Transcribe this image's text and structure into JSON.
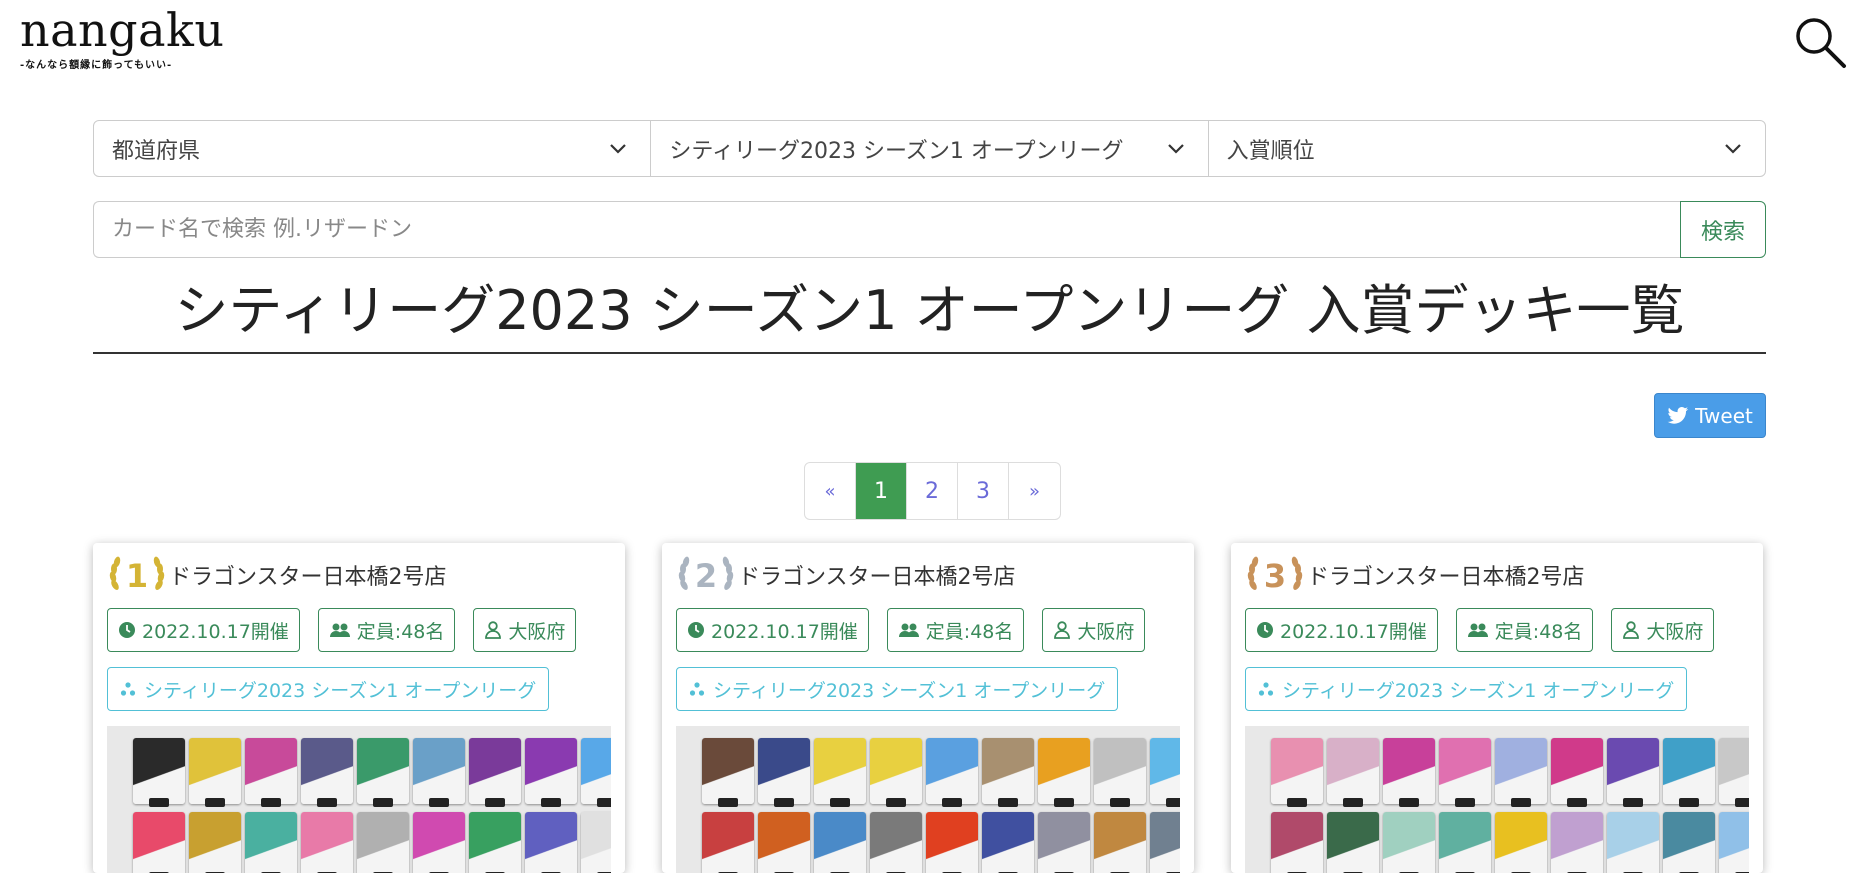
{
  "header": {
    "logo": "nangaku",
    "tagline": "-なんなら額縁に飾ってもいい-"
  },
  "filters": {
    "prefecture": "都道府県",
    "league": "シティリーグ2023 シーズン1 オープンリーグ",
    "rank": "入賞順位"
  },
  "search": {
    "placeholder": "カード名で検索 例.リザードン",
    "button_label": "検索"
  },
  "page_title": "シティリーグ2023 シーズン1 オープンリーグ 入賞デッキ一覧",
  "tweet_label": "Tweet",
  "pagination": {
    "prev": "«",
    "pages": [
      "1",
      "2",
      "3"
    ],
    "next": "»",
    "active": "1"
  },
  "cards": [
    {
      "rank": "1",
      "rank_color": "#d4b435",
      "shop": "ドラゴンスター日本橋2号店",
      "date": "2022.10.17開催",
      "capacity": "定員:48名",
      "prefecture": "大阪府",
      "league": "シティリーグ2023 シーズン1 オープンリーグ",
      "palette": [
        "#2a2a2a",
        "#e0c23a",
        "#c84a9a",
        "#5a5a8a",
        "#3a9a6a",
        "#6aa0c8",
        "#7a3a9a",
        "#8a3ab0",
        "#58a8e8",
        "#e84a6a",
        "#c8a030",
        "#4ab0a0",
        "#e87aa8",
        "#b0b0b0",
        "#d04ab0",
        "#38a060",
        "#6060c0",
        "#e0e0e0"
      ]
    },
    {
      "rank": "2",
      "rank_color": "#aab4c0",
      "shop": "ドラゴンスター日本橋2号店",
      "date": "2022.10.17開催",
      "capacity": "定員:48名",
      "prefecture": "大阪府",
      "league": "シティリーグ2023 シーズン1 オープンリーグ",
      "palette": [
        "#6a4a3a",
        "#3a4a8a",
        "#e8d040",
        "#e8d040",
        "#5aa0e0",
        "#a89070",
        "#e8a020",
        "#c0c0c0",
        "#60b8e8",
        "#c84040",
        "#d06020",
        "#4a8ac8",
        "#7a7a7a",
        "#e04020",
        "#4050a0",
        "#9090a0",
        "#c08840",
        "#708090"
      ]
    },
    {
      "rank": "3",
      "rank_color": "#c8925a",
      "shop": "ドラゴンスター日本橋2号店",
      "date": "2022.10.17開催",
      "capacity": "定員:48名",
      "prefecture": "大阪府",
      "league": "シティリーグ2023 シーズン1 オープンリーグ",
      "palette": [
        "#e890b0",
        "#d8b0c8",
        "#c8409a",
        "#e070b0",
        "#a0b0e0",
        "#d03a8a",
        "#6a4ab0",
        "#40a0c8",
        "#c8c8c8",
        "#b04a6a",
        "#3a6a4a",
        "#a0d0c0",
        "#60b0a0",
        "#e8c020",
        "#c0a0d0",
        "#a8d0e8",
        "#4a8aa0",
        "#90c0e8"
      ]
    }
  ]
}
